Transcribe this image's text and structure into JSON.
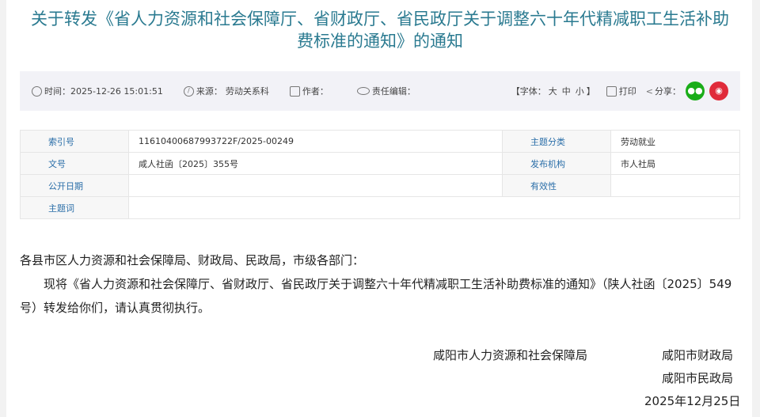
{
  "title": "关于转发《省人力资源和社会保障厅、省财政厅、省民政厅关于调整六十年代精减职工生活补助费标准的通知》的通知",
  "meta": {
    "time_label": "时间：",
    "time": "2025-12-26 15:01:51",
    "source_label": "来源：",
    "source": "劳动关系科",
    "author_label": "作者：",
    "editor_label": "责任编辑：",
    "font_label": "【字体：",
    "font_large": "大",
    "font_mid": "中",
    "font_small": "小",
    "font_end": "】",
    "print": "打印",
    "share": "分享："
  },
  "info": {
    "rows": [
      {
        "k1": "索引号",
        "v1": "11610400687993722F/2025-00249",
        "k2": "主题分类",
        "v2": "劳动就业"
      },
      {
        "k1": "文号",
        "v1": "咸人社函〔2025〕355号",
        "k2": "发布机构",
        "v2": "市人社局"
      },
      {
        "k1": "公开日期",
        "v1": "",
        "k2": "有效性",
        "v2": ""
      },
      {
        "k1": "主题词",
        "v1": ""
      }
    ]
  },
  "content": {
    "greeting": "各县市区人力资源和社会保障局、财政局、民政局，市级各部门：",
    "para": "现将《省人力资源和社会保障厅、省财政厅、省民政厅关于调整六十年代精减职工生活补助费标准的通知》（陕人社函〔2025〕549号）转发给你们，请认真贯彻执行。"
  },
  "signature": {
    "org1": "咸阳市人力资源和社会保障局",
    "org2": "咸阳市财政局",
    "org3": "咸阳市民政局",
    "date": "2025年12月25日"
  },
  "colors": {
    "title": "#2a7a90",
    "wechat": "#1aad19",
    "weibo": "#e02b3a"
  }
}
